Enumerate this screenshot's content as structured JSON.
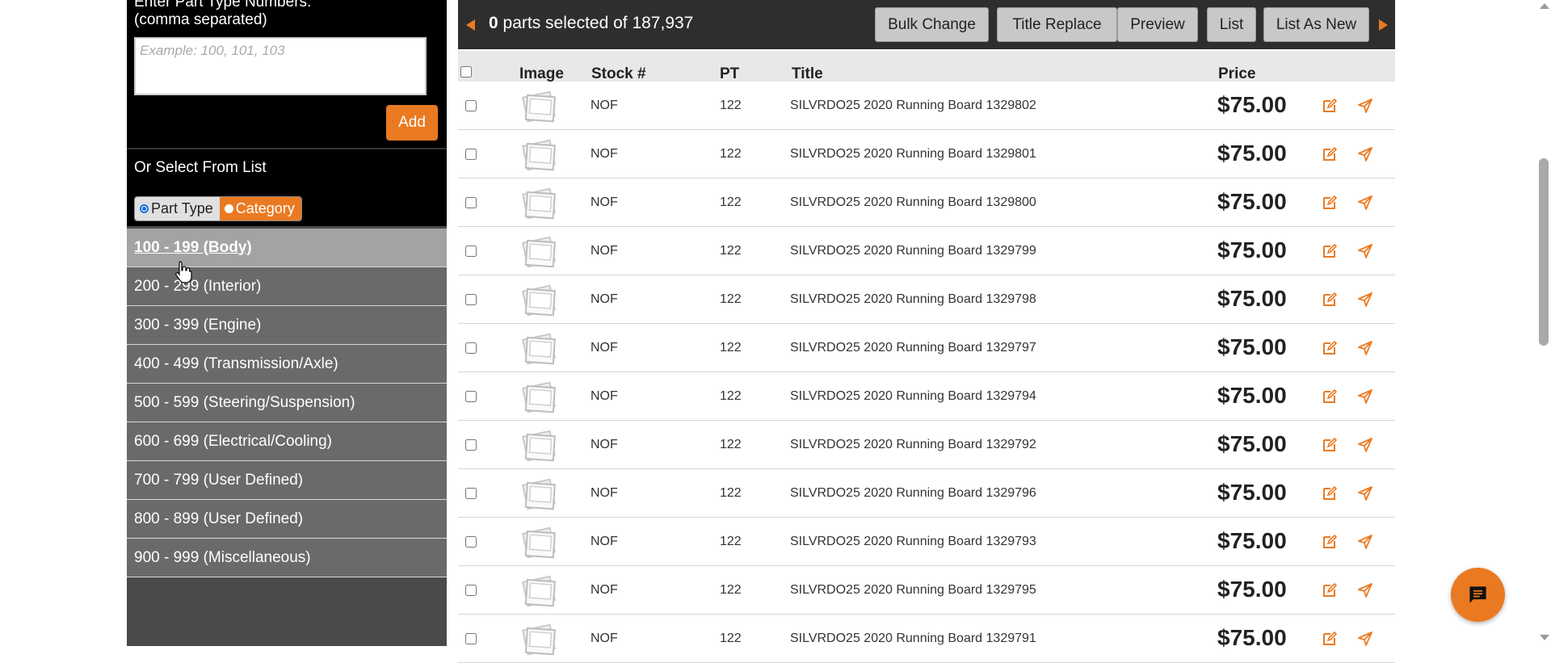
{
  "sidebar": {
    "enter_label_line1": "Enter Part Type Numbers:",
    "enter_label_line2": "(comma separated)",
    "input_placeholder": "Example: 100, 101, 103",
    "add_label": "Add",
    "select_label": "Or Select From List",
    "toggle": {
      "part_type": "Part Type",
      "category": "Category",
      "selected": "Part Type"
    },
    "ranges": [
      "100 - 199 (Body)",
      "200 - 299 (Interior)",
      "300 - 399 (Engine)",
      "400 - 499 (Transmission/Axle)",
      "500 - 599 (Steering/Suspension)",
      "600 - 699 (Electrical/Cooling)",
      "700 - 799 (User Defined)",
      "800 - 899 (User Defined)",
      "900 - 999 (Miscellaneous)"
    ],
    "active_range": "100 - 199 (Body)"
  },
  "toolbar": {
    "selected_count": "0",
    "selected_text": "parts selected of 187,937",
    "buttons": {
      "bulk_change": "Bulk Change",
      "title_replace": "Title Replace",
      "preview": "Preview",
      "list": "List",
      "list_as_new": "List As New"
    }
  },
  "table": {
    "headers": {
      "image": "Image",
      "stock": "Stock #",
      "pt": "PT",
      "title": "Title",
      "price": "Price"
    },
    "rows": [
      {
        "stock": "NOF",
        "pt": "122",
        "title": "SILVRDO25 2020 Running Board 1329802",
        "price": "$75.00"
      },
      {
        "stock": "NOF",
        "pt": "122",
        "title": "SILVRDO25 2020 Running Board 1329801",
        "price": "$75.00"
      },
      {
        "stock": "NOF",
        "pt": "122",
        "title": "SILVRDO25 2020 Running Board 1329800",
        "price": "$75.00"
      },
      {
        "stock": "NOF",
        "pt": "122",
        "title": "SILVRDO25 2020 Running Board 1329799",
        "price": "$75.00"
      },
      {
        "stock": "NOF",
        "pt": "122",
        "title": "SILVRDO25 2020 Running Board 1329798",
        "price": "$75.00"
      },
      {
        "stock": "NOF",
        "pt": "122",
        "title": "SILVRDO25 2020 Running Board 1329797",
        "price": "$75.00"
      },
      {
        "stock": "NOF",
        "pt": "122",
        "title": "SILVRDO25 2020 Running Board 1329794",
        "price": "$75.00"
      },
      {
        "stock": "NOF",
        "pt": "122",
        "title": "SILVRDO25 2020 Running Board 1329792",
        "price": "$75.00"
      },
      {
        "stock": "NOF",
        "pt": "122",
        "title": "SILVRDO25 2020 Running Board 1329796",
        "price": "$75.00"
      },
      {
        "stock": "NOF",
        "pt": "122",
        "title": "SILVRDO25 2020 Running Board 1329793",
        "price": "$75.00"
      },
      {
        "stock": "NOF",
        "pt": "122",
        "title": "SILVRDO25 2020 Running Board 1329795",
        "price": "$75.00"
      },
      {
        "stock": "NOF",
        "pt": "122",
        "title": "SILVRDO25 2020 Running Board 1329791",
        "price": "$75.00"
      }
    ]
  },
  "icons": {
    "image_placeholder": "photo-placeholder-icon",
    "edit": "edit-icon",
    "send": "send-icon",
    "chat": "chat-icon",
    "prev": "prev-page-arrow-icon",
    "next": "next-page-arrow-icon"
  },
  "colors": {
    "accent": "#ea7a22",
    "toolbar_bg": "#2e2e2e",
    "sidebar_bg": "#000000",
    "range_bg": "#6a6a6a",
    "range_active_bg": "#a3a3a3"
  }
}
